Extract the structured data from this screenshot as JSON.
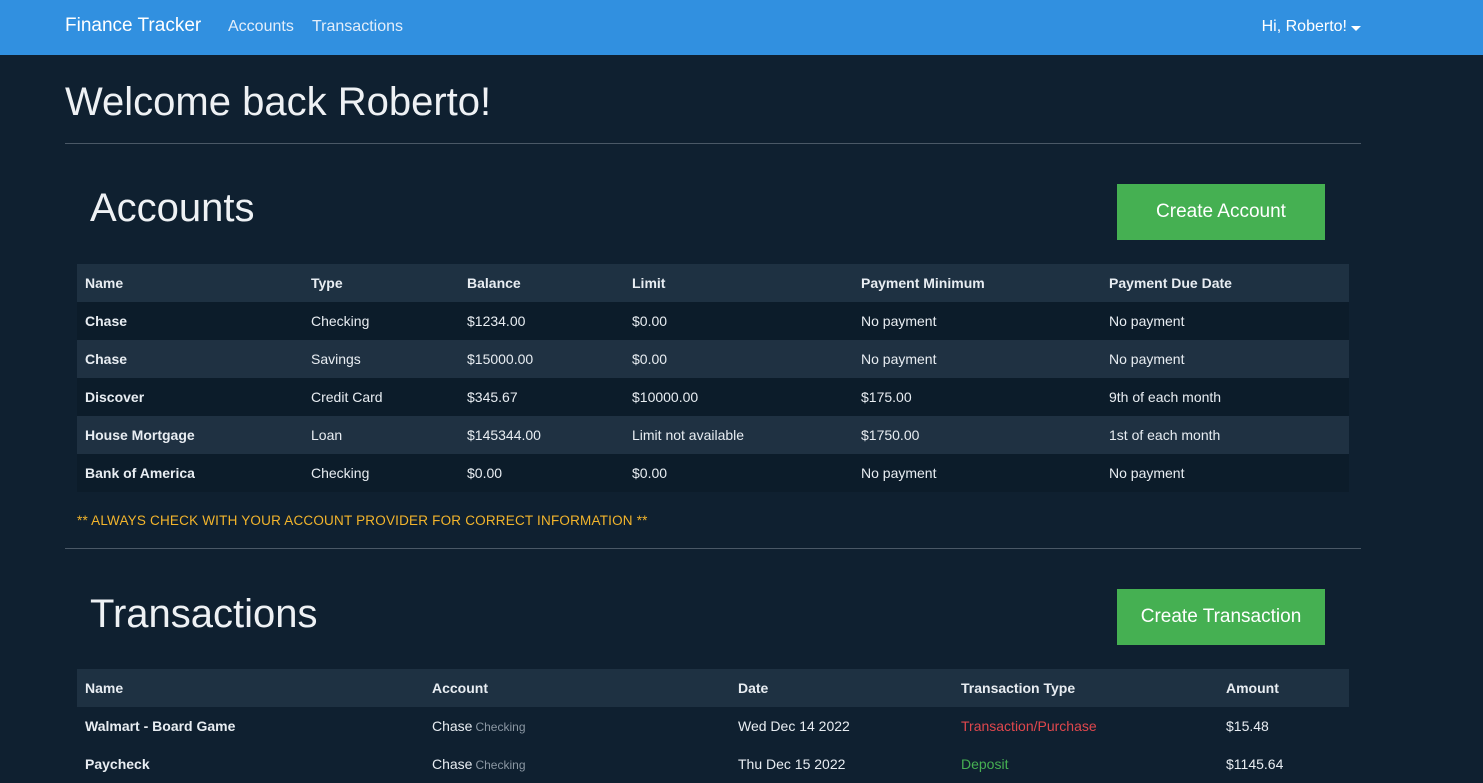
{
  "navbar": {
    "brand": "Finance Tracker",
    "links": [
      "Accounts",
      "Transactions"
    ],
    "user_greeting": "Hi, Roberto!"
  },
  "welcome": "Welcome back Roberto!",
  "accounts": {
    "title": "Accounts",
    "create_label": "Create Account",
    "columns": [
      "Name",
      "Type",
      "Balance",
      "Limit",
      "Payment Minimum",
      "Payment Due Date"
    ],
    "rows": [
      [
        "Chase",
        "Checking",
        "$1234.00",
        "$0.00",
        "No payment",
        "No payment"
      ],
      [
        "Chase",
        "Savings",
        "$15000.00",
        "$0.00",
        "No payment",
        "No payment"
      ],
      [
        "Discover",
        "Credit Card",
        "$345.67",
        "$10000.00",
        "$175.00",
        "9th of each month"
      ],
      [
        "House Mortgage",
        "Loan",
        "$145344.00",
        "Limit not available",
        "$1750.00",
        "1st of each month"
      ],
      [
        "Bank of America",
        "Checking",
        "$0.00",
        "$0.00",
        "No payment",
        "No payment"
      ]
    ],
    "disclaimer": "** ALWAYS CHECK WITH YOUR ACCOUNT PROVIDER FOR CORRECT INFORMATION **"
  },
  "transactions": {
    "title": "Transactions",
    "create_label": "Create Transaction",
    "columns": [
      "Name",
      "Account",
      "Date",
      "Transaction Type",
      "Amount"
    ],
    "rows": [
      {
        "name": "Walmart - Board Game",
        "account": "Chase",
        "account_type": "Checking",
        "date": "Wed Dec 14 2022",
        "type": "Transaction/Purchase",
        "amount": "$15.48"
      },
      {
        "name": "Paycheck",
        "account": "Chase",
        "account_type": "Checking",
        "date": "Thu Dec 15 2022",
        "type": "Deposit",
        "amount": "$1145.64"
      }
    ]
  },
  "colors": {
    "navbar": "#3190e0",
    "background": "#0f2030",
    "button": "#45b052",
    "warning": "#f3b52c",
    "purchase": "#e0474d",
    "deposit": "#46b052"
  }
}
